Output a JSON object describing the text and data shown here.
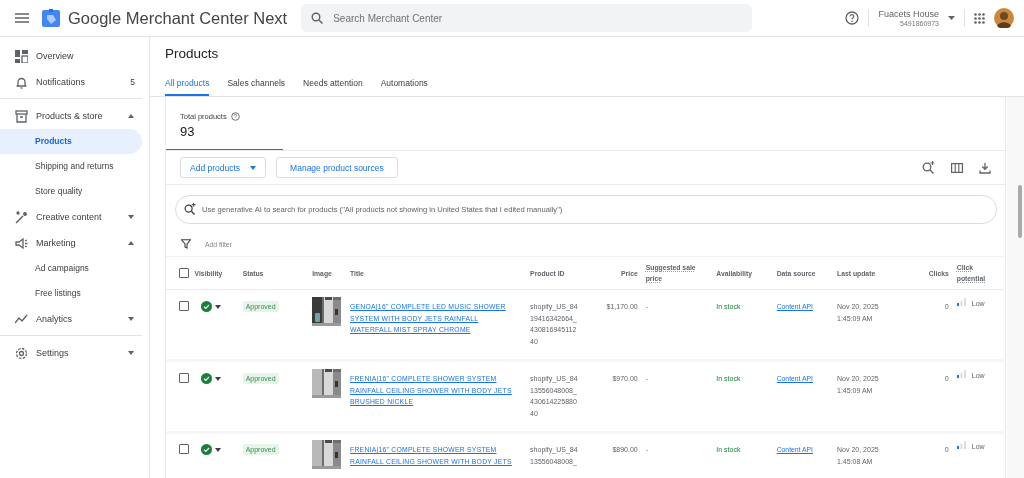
{
  "app": {
    "title": "Google Merchant Center Next",
    "search_placeholder": "Search Merchant Center"
  },
  "account": {
    "name": "Fuacets House",
    "id": "5491860973"
  },
  "sidebar": {
    "items": [
      {
        "label": "Overview",
        "selected": false
      },
      {
        "label": "Notifications",
        "count": "5",
        "selected": false,
        "divider_after": true
      },
      {
        "label": "Products & store",
        "expanded": true,
        "selected": false,
        "children": [
          {
            "label": "Products",
            "selected": true
          },
          {
            "label": "Shipping and returns",
            "selected": false
          },
          {
            "label": "Store quality",
            "selected": false
          }
        ]
      },
      {
        "label": "Creative content",
        "expanded": false,
        "selected": false
      },
      {
        "label": "Marketing",
        "expanded": true,
        "selected": false,
        "children": [
          {
            "label": "Ad campaigns",
            "selected": false
          },
          {
            "label": "Free listings",
            "selected": false
          }
        ]
      },
      {
        "label": "Analytics",
        "expanded": false,
        "selected": false,
        "divider_after": true
      },
      {
        "label": "Settings",
        "expanded": false,
        "selected": false
      }
    ]
  },
  "page": {
    "title": "Products",
    "tabs": [
      {
        "label": "All products",
        "selected": true
      },
      {
        "label": "Sales channels",
        "selected": false
      },
      {
        "label": "Needs attention",
        "selected": false
      },
      {
        "label": "Automations",
        "selected": false
      }
    ],
    "summary": {
      "label": "Total products",
      "value": "93"
    },
    "buttons": [
      "Add products",
      "Manage product sources"
    ],
    "ai_search_placeholder": "Use generative AI to search for products (\"All products not showing in United States that I edited manually\")",
    "filter_label": "Add filter"
  },
  "table": {
    "select_all_checked": false,
    "columns": [
      "Visibility",
      "Status",
      "Image",
      "Title",
      "Product ID",
      "Price",
      "Suggested sale price",
      "Availability",
      "Data source",
      "Last update",
      "Clicks",
      "Click potential"
    ],
    "rows": [
      {
        "checked": false,
        "visible": true,
        "status": "Approved",
        "title": "GENOA|16\" COMPLETE LED MUSIC SHOWER SYSTEM WITH BODY JETS RAINFALL WATERFALL MIST SPRAY CHROME",
        "product_id": "shopify_US_8419416342664_43081694511240",
        "price": "$1,170.00",
        "sale_price": "-",
        "availability": "In stock",
        "data_source": "Content API",
        "last_update": "Nov 20, 2025 1:45:09 AM",
        "clicks": "0",
        "click_potential": "Low"
      },
      {
        "checked": false,
        "visible": true,
        "status": "Approved",
        "title": "FRENIA|16\" COMPLETE SHOWER SYSTEM RAINFALL CEILING SHOWER WITH BODY JETS BRUSHED NICKLE",
        "product_id": "shopify_US_8413556048008_43061422588040",
        "price": "$970.00",
        "sale_price": "-",
        "availability": "In stock",
        "data_source": "Content API",
        "last_update": "Nov 20, 2025 1:45:09 AM",
        "clicks": "0",
        "click_potential": "Low"
      },
      {
        "checked": false,
        "visible": true,
        "status": "Approved",
        "title": "FRENIA|16\" COMPLETE SHOWER SYSTEM RAINFALL CEILING SHOWER WITH BODY JETS",
        "product_id": "shopify_US_8413556048008_",
        "price": "$890.00",
        "sale_price": "-",
        "availability": "In stock",
        "data_source": "Content API",
        "last_update": "Nov 20, 2025 1:45:08 AM",
        "clicks": "0",
        "click_potential": "Low"
      }
    ]
  }
}
